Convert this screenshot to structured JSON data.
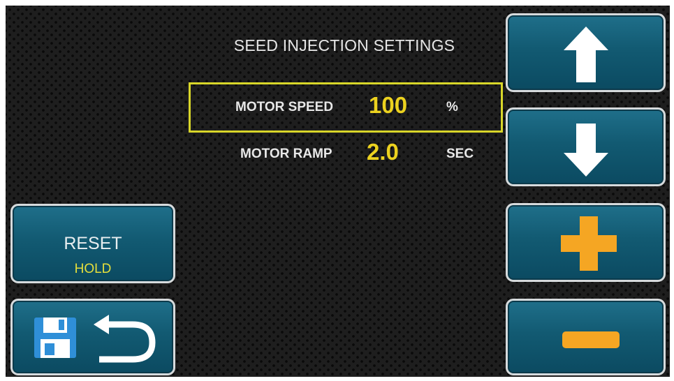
{
  "screen": {
    "title": "SEED INJECTION SETTINGS"
  },
  "settings": [
    {
      "label": "MOTOR SPEED",
      "value": "100",
      "unit": "%",
      "selected": true
    },
    {
      "label": "MOTOR RAMP",
      "value": "2.0",
      "unit": "SEC",
      "selected": false
    }
  ],
  "buttons": {
    "reset": {
      "label": "RESET",
      "sublabel": "HOLD"
    },
    "save": {
      "icons": [
        "floppy-disk-icon",
        "return-arrow-icon"
      ]
    },
    "up": {
      "icon": "arrow-up-icon"
    },
    "down": {
      "icon": "arrow-down-icon"
    },
    "plus": {
      "icon": "plus-icon"
    },
    "minus": {
      "icon": "minus-icon"
    }
  },
  "colors": {
    "background": "#1e1e1e",
    "highlight": "#d8d629",
    "value": "#ecd21f",
    "button": "#125a72",
    "plus_minus": "#f5a623"
  }
}
